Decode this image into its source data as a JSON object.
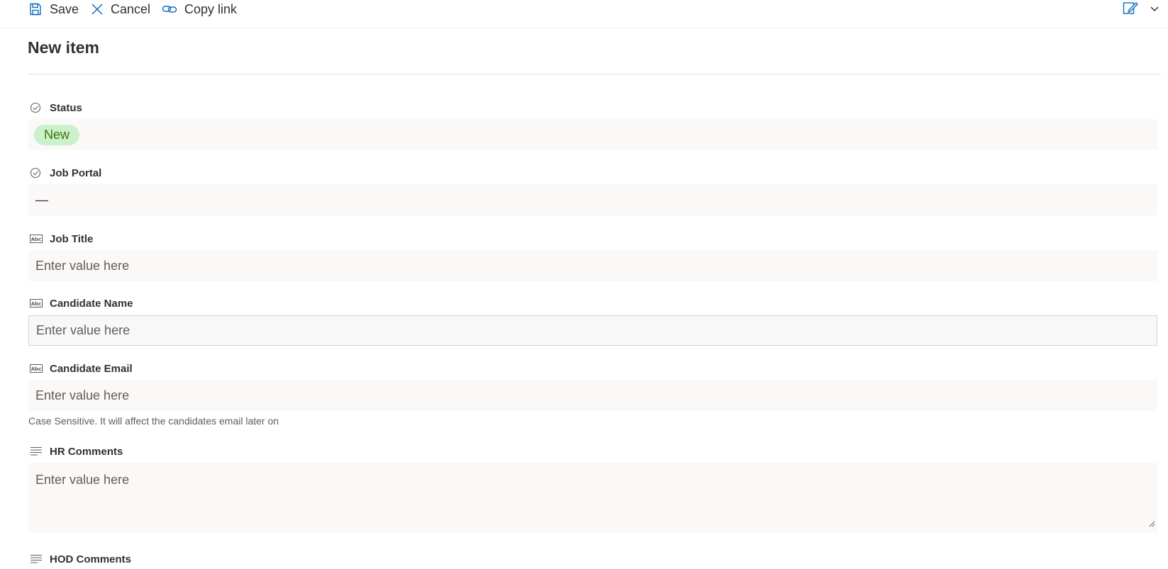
{
  "toolbar": {
    "save_label": "Save",
    "cancel_label": "Cancel",
    "copy_link_label": "Copy link",
    "icons": {
      "save": "save-icon",
      "cancel": "close-icon",
      "copy_link": "link-icon",
      "edit_form": "edit-form-icon",
      "more": "chevron-down-icon"
    }
  },
  "page": {
    "title": "New item"
  },
  "fields": {
    "status": {
      "label": "Status",
      "icon": "choice-check-icon",
      "value": "New"
    },
    "job_portal": {
      "label": "Job Portal",
      "icon": "choice-check-icon",
      "value": "—"
    },
    "job_title": {
      "label": "Job Title",
      "icon": "text-field-icon",
      "placeholder": "Enter value here"
    },
    "candidate_name": {
      "label": "Candidate Name",
      "icon": "text-field-icon",
      "placeholder": "Enter value here"
    },
    "candidate_email": {
      "label": "Candidate Email",
      "icon": "text-field-icon",
      "placeholder": "Enter value here",
      "helper": "Case Sensitive. It will affect the candidates email later on"
    },
    "hr_comments": {
      "label": "HR Comments",
      "icon": "multiline-text-icon",
      "placeholder": "Enter value here"
    },
    "hod_comments": {
      "label": "HOD Comments",
      "icon": "multiline-text-icon"
    }
  },
  "colors": {
    "accent": "#0f6cbd",
    "status_pill_bg": "#caf0cc",
    "status_pill_text": "#437406",
    "field_bg": "#faf9f8"
  }
}
